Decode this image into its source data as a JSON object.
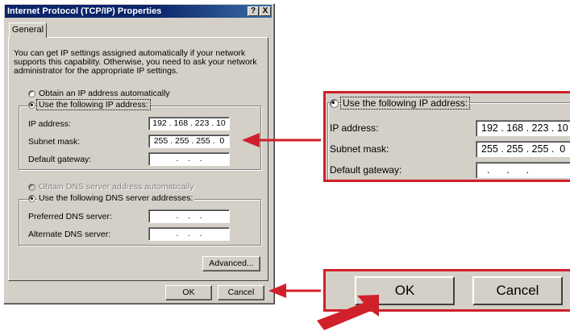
{
  "dialog": {
    "title": "Internet Protocol (TCP/IP) Properties",
    "help_button": "?",
    "close_button": "X",
    "tab_general": "General",
    "intro_text": "You can get IP settings assigned automatically if your network supports this capability. Otherwise, you need to ask your network administrator for the appropriate IP settings.",
    "ip_section": {
      "obtain_auto_label": "Obtain an IP address automatically",
      "obtain_auto_selected": false,
      "use_following_label": "Use the following IP address:",
      "use_following_selected": true,
      "ip_address_label": "IP address:",
      "ip_address_value": "192 . 168 . 223 . 10",
      "subnet_mask_label": "Subnet mask:",
      "subnet_mask_value": "255 . 255 . 255 .  0",
      "default_gateway_label": "Default gateway:",
      "default_gateway_value": "  .    .    .  "
    },
    "dns_section": {
      "obtain_auto_label": "Obtain DNS server address automatically",
      "use_following_label": "Use the following DNS server addresses:",
      "preferred_label": "Preferred DNS server:",
      "preferred_value": "  .    .    .  ",
      "alternate_label": "Alternate DNS server:",
      "alternate_value": "  .    .    .  "
    },
    "advanced_button": "Advanced...",
    "ok_button": "OK",
    "cancel_button": "Cancel"
  },
  "zoom_ip": {
    "use_following_label": "Use the following IP address:",
    "ip_address_label": "IP address:",
    "ip_address_value": "192 . 168 . 223 . 10",
    "subnet_mask_label": "Subnet mask:",
    "subnet_mask_value": "255 . 255 . 255 .  0",
    "default_gateway_label": "Default gateway:",
    "default_gateway_value": "  .      .      .  "
  },
  "zoom_buttons": {
    "ok_button": "OK",
    "cancel_button": "Cancel"
  },
  "colors": {
    "highlight_red": "#d0202a",
    "titlebar_blue": "#0a246a",
    "dialog_gray": "#d4d0c8"
  },
  "icons": [
    "help-icon",
    "close-icon",
    "arrow-left-icon",
    "pointer-arrow-icon"
  ]
}
